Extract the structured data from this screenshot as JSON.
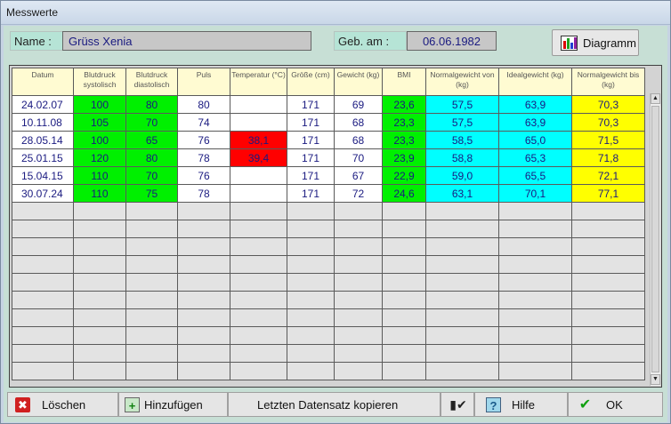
{
  "window": {
    "title": "Messwerte"
  },
  "header": {
    "name_label": "Name :",
    "name_value": "Grüss Xenia",
    "birth_label": "Geb. am :",
    "birth_value": "06.06.1982",
    "diagram_label": "Diagramm"
  },
  "table": {
    "columns": [
      "Datum",
      "Blutdruck systolisch",
      "Blutdruck diastolisch",
      "Puls",
      "Temperatur (°C)",
      "Größe (cm)",
      "Gewicht (kg)",
      "BMI",
      "Normalgewicht von (kg)",
      "Idealgewicht (kg)",
      "Normalgewicht bis (kg)"
    ],
    "rows": [
      [
        "24.02.07",
        "100",
        "80",
        "80",
        "",
        "171",
        "69",
        "23,6",
        "57,5",
        "63,9",
        "70,3"
      ],
      [
        "10.11.08",
        "105",
        "70",
        "74",
        "",
        "171",
        "68",
        "23,3",
        "57,5",
        "63,9",
        "70,3"
      ],
      [
        "28.05.14",
        "100",
        "65",
        "76",
        "38,1",
        "171",
        "68",
        "23,3",
        "58,5",
        "65,0",
        "71,5"
      ],
      [
        "25.01.15",
        "120",
        "80",
        "78",
        "39,4",
        "171",
        "70",
        "23,9",
        "58,8",
        "65,3",
        "71,8"
      ],
      [
        "15.04.15",
        "110",
        "70",
        "76",
        "",
        "171",
        "67",
        "22,9",
        "59,0",
        "65,5",
        "72,1"
      ],
      [
        "30.07.24",
        "110",
        "75",
        "78",
        "",
        "171",
        "72",
        "24,6",
        "63,1",
        "70,1",
        "77,1"
      ]
    ],
    "empty_rows": 10
  },
  "buttons": {
    "delete": "Löschen",
    "add": "Hinzufügen",
    "copy_last": "Letzten Datensatz kopieren",
    "help": "Hilfe",
    "ok": "OK"
  },
  "colors": {
    "green": "#00f000",
    "cyan": "#00ffff",
    "yellow": "#ffff00",
    "red": "#ff0000"
  },
  "icons": [
    "close-x-icon",
    "plus-icon",
    "phone-check-icon",
    "question-icon",
    "checkmark-icon",
    "bar-chart-icon"
  ]
}
